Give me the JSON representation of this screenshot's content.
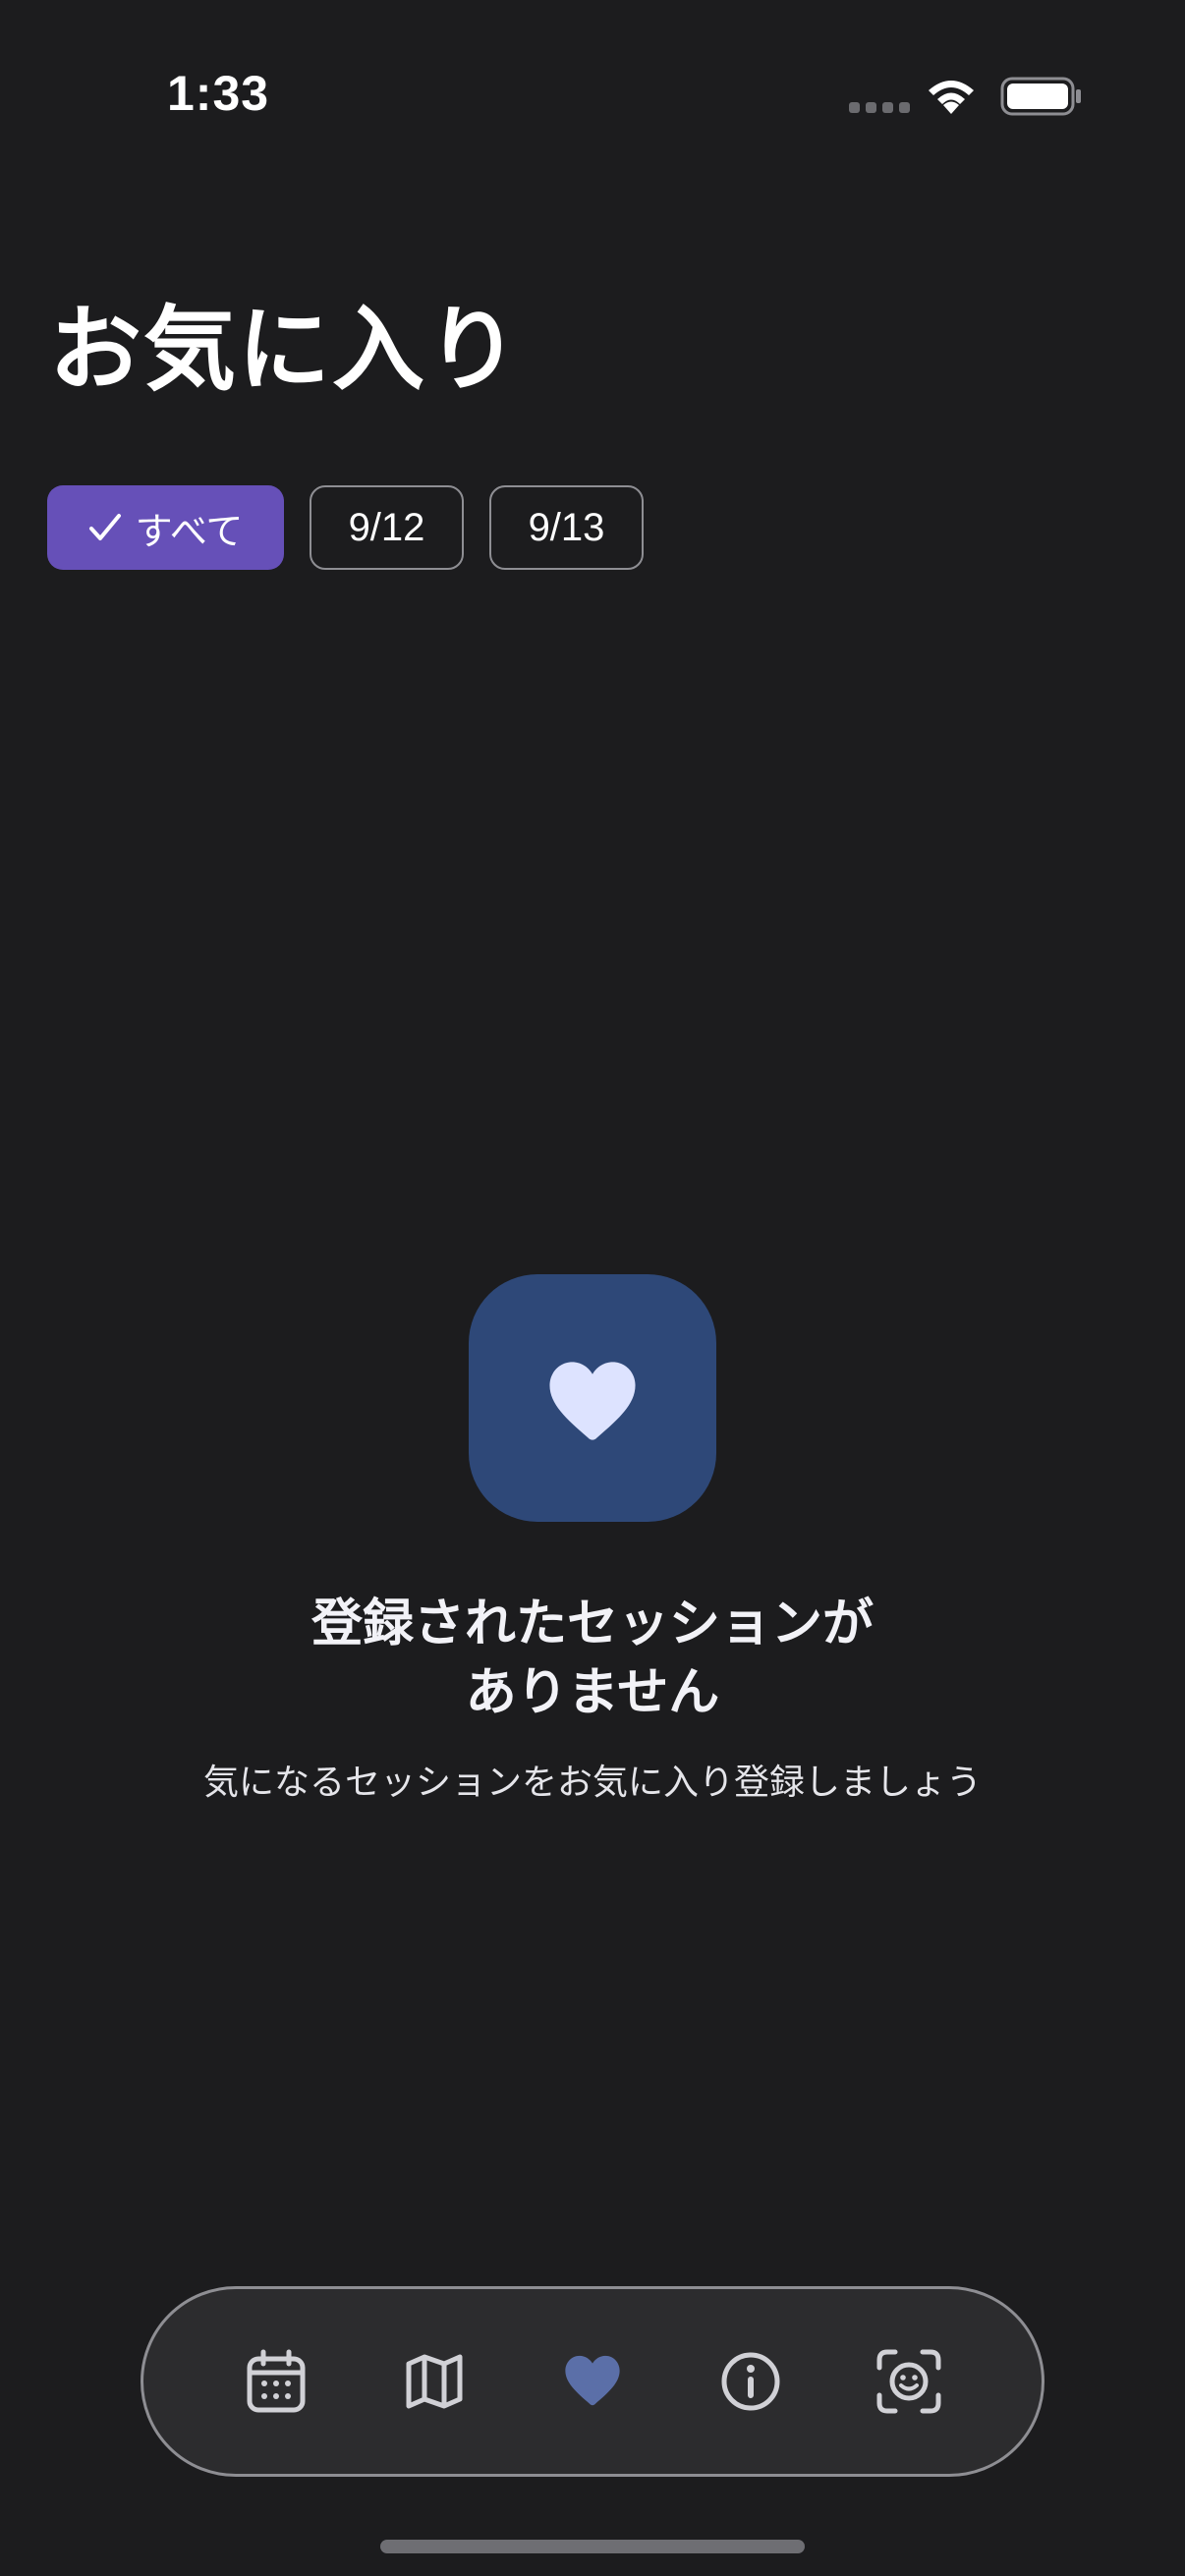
{
  "status_bar": {
    "time": "1:33",
    "icons": [
      "cellular-dots-icon",
      "wifi-icon",
      "battery-icon"
    ]
  },
  "page": {
    "title": "お気に入り"
  },
  "filters": {
    "items": [
      {
        "label": "すべて",
        "selected": true,
        "icon": "checkmark-icon"
      },
      {
        "label": "9/12",
        "selected": false
      },
      {
        "label": "9/13",
        "selected": false
      }
    ]
  },
  "empty_state": {
    "icon": "heart-icon",
    "title_line1": "登録されたセッションが",
    "title_line2": "ありません",
    "subtitle": "気になるセッションをお気に入り登録しましょう"
  },
  "tab_bar": {
    "items": [
      {
        "icon": "calendar-icon",
        "active": false
      },
      {
        "icon": "map-icon",
        "active": false
      },
      {
        "icon": "heart-icon",
        "active": true
      },
      {
        "icon": "info-icon",
        "active": false
      },
      {
        "icon": "face-scan-icon",
        "active": false
      }
    ]
  },
  "colors": {
    "background": "#1c1c1e",
    "accent": "#6650b8",
    "empty_icon_bg": "#2e4878",
    "active_tab": "#5b6fa8",
    "inactive_tab": "#d1d1d6"
  }
}
